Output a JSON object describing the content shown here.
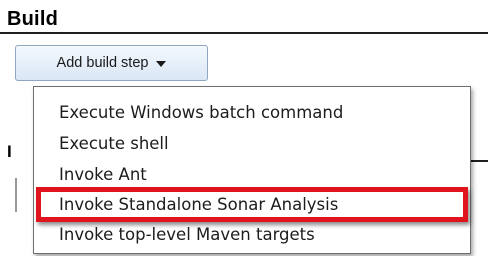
{
  "section": {
    "title": "Build"
  },
  "toolbar": {
    "add_build_step_label": "Add build step",
    "caret_icon": "caret-down-icon"
  },
  "background": {
    "partial_heading_glyph": "I"
  },
  "menu": {
    "items": [
      {
        "label": "Execute Windows batch command",
        "highlighted": false
      },
      {
        "label": "Execute shell",
        "highlighted": false
      },
      {
        "label": "Invoke Ant",
        "highlighted": false
      },
      {
        "label": "Invoke Standalone Sonar Analysis",
        "highlighted": true
      },
      {
        "label": "Invoke top-level Maven targets",
        "highlighted": false
      }
    ]
  },
  "colors": {
    "highlight_border": "#e0141c",
    "button_gradient_top": "#f4f8fd",
    "button_gradient_bottom": "#dae7f6",
    "button_border": "#8fa7c3"
  }
}
